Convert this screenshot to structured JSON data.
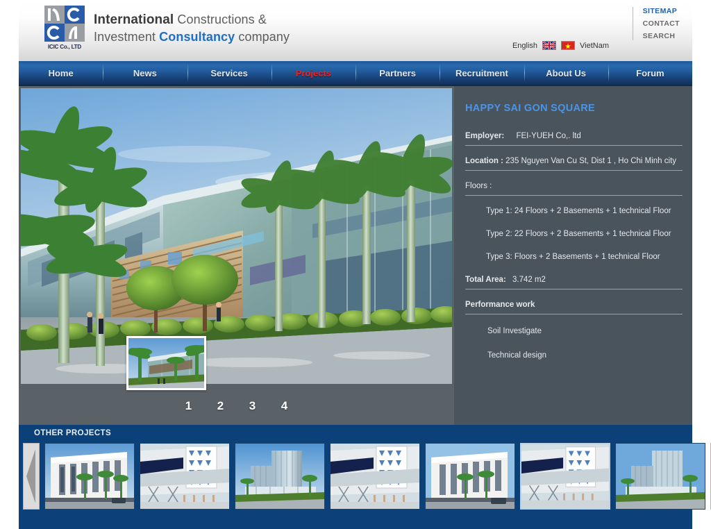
{
  "brand": {
    "line1_strong": "International",
    "line1_rest": " Constructions &",
    "line2_a": "Investment ",
    "line2_blue": "Consultancy",
    "line2_c": " company",
    "logo_caption": "ICIC Co., LTD"
  },
  "header": {
    "lang_en": "English",
    "lang_vn": "VietNam",
    "flag_en_name": "uk-flag-icon",
    "flag_vn_name": "vietnam-flag-icon",
    "util": [
      {
        "label": "SITEMAP",
        "highlight": true
      },
      {
        "label": "CONTACT",
        "highlight": false
      },
      {
        "label": "SEARCH",
        "highlight": false
      }
    ]
  },
  "nav": {
    "items": [
      {
        "label": "Home",
        "active": false
      },
      {
        "label": "News",
        "active": false
      },
      {
        "label": "Services",
        "active": false
      },
      {
        "label": "Projects",
        "active": true
      },
      {
        "label": "Partners",
        "active": false
      },
      {
        "label": "Recruitment",
        "active": false
      },
      {
        "label": "About Us",
        "active": false
      },
      {
        "label": "Forum",
        "active": false
      }
    ]
  },
  "hero": {
    "pagination": [
      "1",
      "2",
      "3",
      "4"
    ],
    "inset_name": "hero-inset-thumbnail"
  },
  "project": {
    "title": "HAPPY SAI GON SQUARE",
    "employer_label": "Employer:",
    "employer_value": "FEI-YUEH Co,. ltd",
    "location_label": "Location :",
    "location_value": "235 Nguyen Van Cu St, Dist 1 , Ho Chi Minh city",
    "floors_label": "Floors :",
    "floors": [
      "Type 1: 24 Floors + 2 Basements + 1 technical Floor",
      "Type 2: 22 Floors + 2 Basements + 1 technical Floor",
      "Type 3: Floors + 2 Basements + 1 technical Floor"
    ],
    "total_area_label": "Total Area:",
    "total_area_value": "3.742 m2",
    "performance_label": "Performance work",
    "performance": [
      "Soil Investigate",
      "Technical design"
    ]
  },
  "other_projects": {
    "title": "OTHER PROJECTS",
    "prev_label": "prev-arrow",
    "next_label": "next-arrow",
    "thumbs": [
      {
        "kind": "classic",
        "selected": false
      },
      {
        "kind": "lattice",
        "selected": false
      },
      {
        "kind": "tower",
        "selected": false
      },
      {
        "kind": "lattice",
        "selected": false
      },
      {
        "kind": "classic",
        "selected": false
      },
      {
        "kind": "lattice",
        "selected": true
      },
      {
        "kind": "tower",
        "selected": false
      }
    ]
  },
  "colors": {
    "nav_blue": "#1d5898",
    "accent_red": "#ff1c1c",
    "panel_gray": "#4a545c",
    "hero_gray": "#5a6268",
    "footer_blue": "#0b4078",
    "title_blue": "#4b95e8",
    "link_blue": "#1f5fb0"
  }
}
